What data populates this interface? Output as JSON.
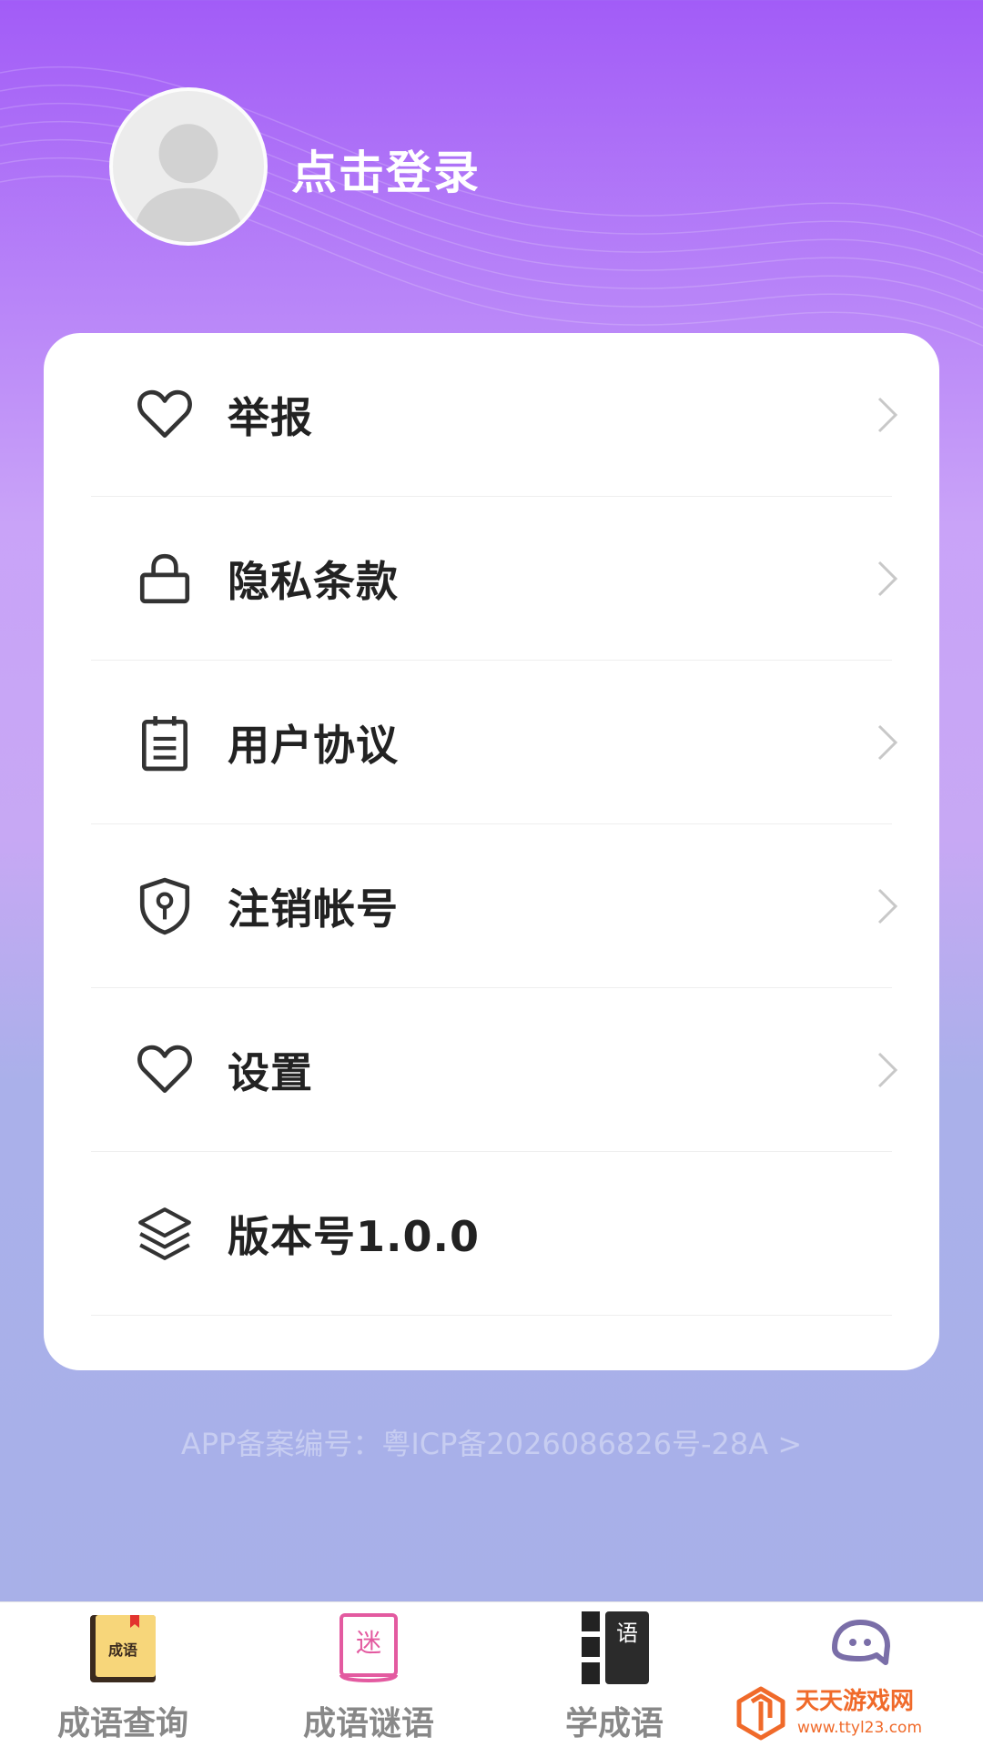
{
  "header": {
    "login_text": "点击登录"
  },
  "menu": {
    "items": [
      {
        "label": "举报",
        "icon": "heart-icon",
        "has_chevron": true
      },
      {
        "label": "隐私条款",
        "icon": "lock-icon",
        "has_chevron": true
      },
      {
        "label": "用户协议",
        "icon": "document-icon",
        "has_chevron": true
      },
      {
        "label": "注销帐号",
        "icon": "shield-key-icon",
        "has_chevron": true
      },
      {
        "label": "设置",
        "icon": "heart-icon",
        "has_chevron": true
      },
      {
        "label": "版本号1.0.0",
        "icon": "layers-icon",
        "has_chevron": false
      }
    ]
  },
  "footer": {
    "icp_text": "APP备案编号：粤ICP备2026086826号-28A >"
  },
  "tabbar": {
    "tabs": [
      {
        "label": "成语查询",
        "icon_text": "成语",
        "icon": "book-icon"
      },
      {
        "label": "成语谜语",
        "icon_text": "迷",
        "icon": "riddle-book-icon"
      },
      {
        "label": "学成语",
        "icon_text": "语",
        "icon": "study-icon"
      },
      {
        "label": "",
        "icon": "chat-bot-icon"
      }
    ]
  },
  "watermark": {
    "brand": "天天游戏网",
    "url": "www.ttyl23.com"
  },
  "colors": {
    "gradient_top": "#a25cf7",
    "gradient_bottom": "#a7b0e8",
    "card_bg": "#ffffff",
    "text_dark": "#222222",
    "tab_label": "#888888",
    "watermark_orange": "#f06a2a"
  }
}
